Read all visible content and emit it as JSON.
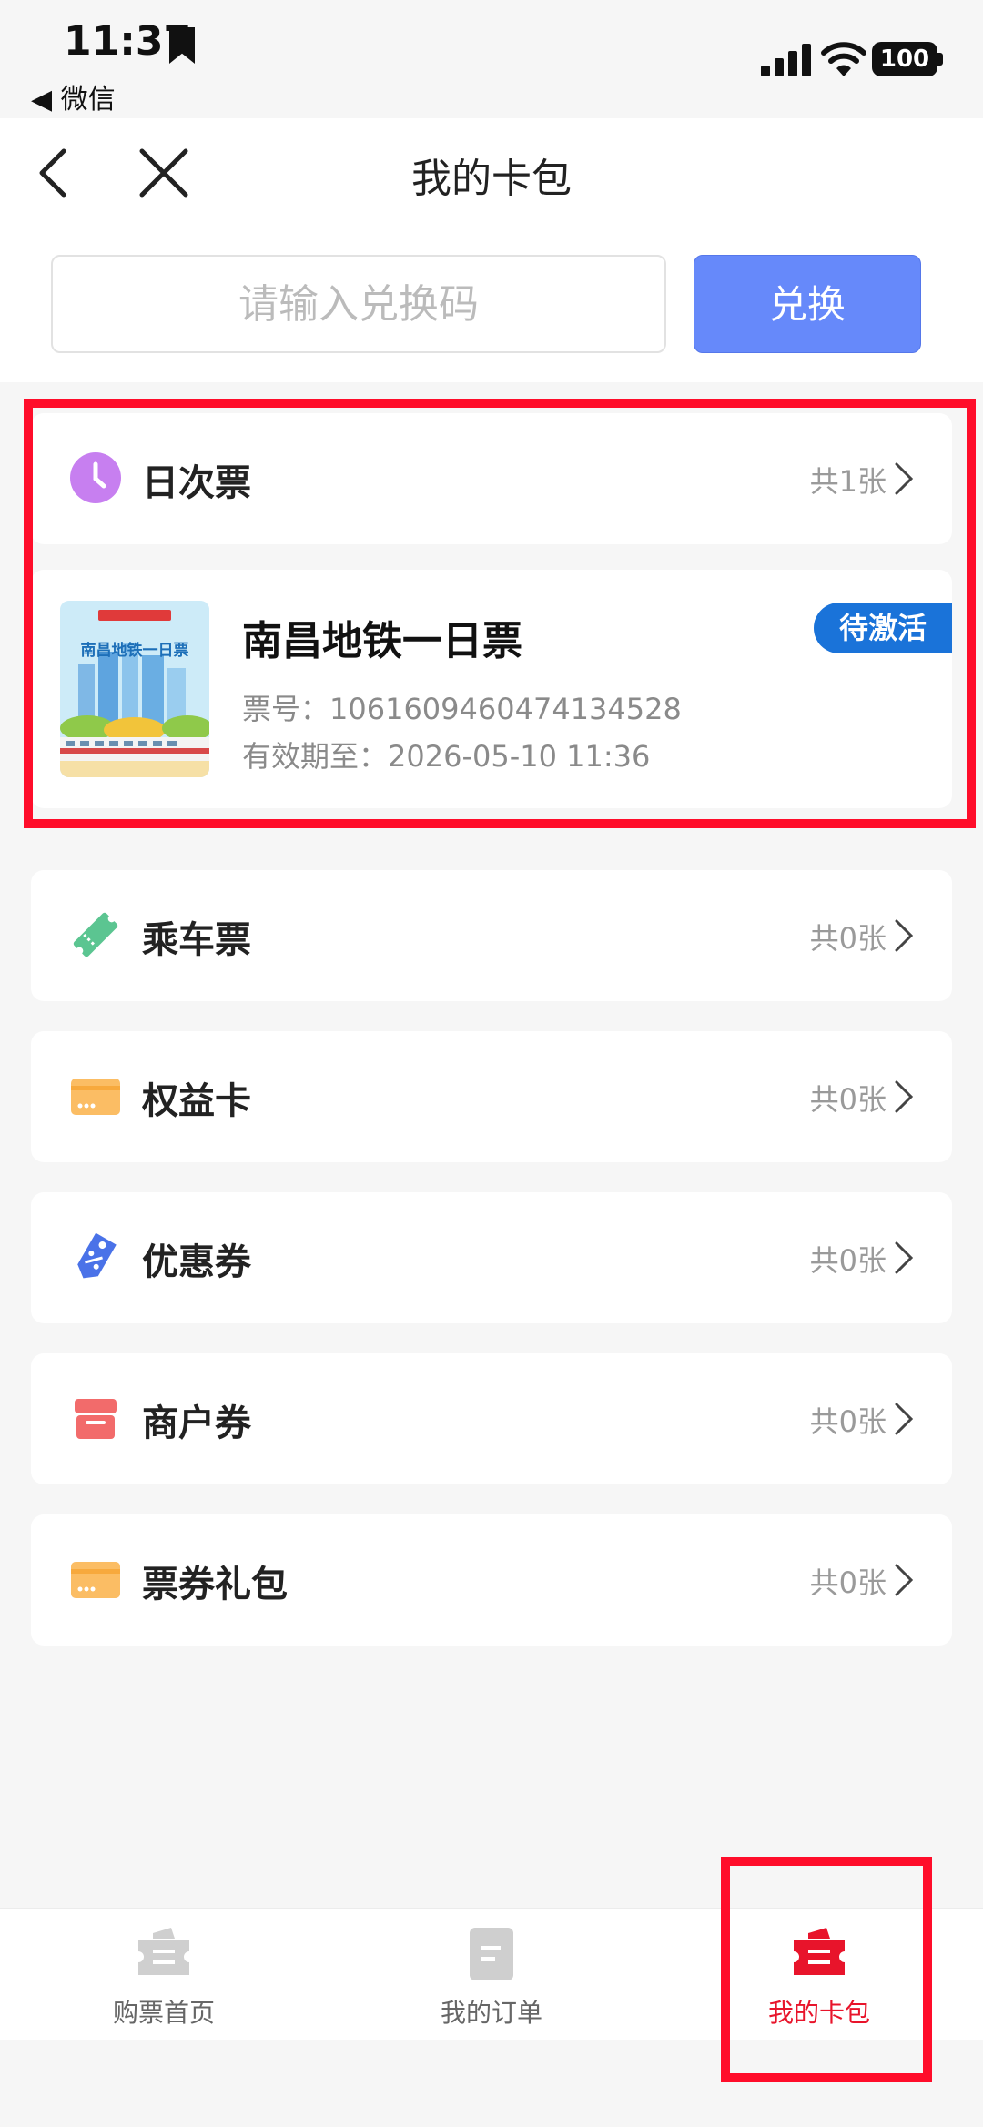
{
  "status_bar": {
    "time": "11:37",
    "back_app": "◀ 微信",
    "battery": "100"
  },
  "header": {
    "title": "我的卡包"
  },
  "redeem": {
    "placeholder": "请输入兑换码",
    "button": "兑换"
  },
  "sections": [
    {
      "label": "日次票",
      "count": "共1张",
      "icon": "clock-icon",
      "color": "#c77ff0"
    },
    {
      "label": "乘车票",
      "count": "共0张",
      "icon": "ticket-icon",
      "color": "#5bc591"
    },
    {
      "label": "权益卡",
      "count": "共0张",
      "icon": "card-icon",
      "color": "#fbbd64"
    },
    {
      "label": "优惠券",
      "count": "共0张",
      "icon": "tag-icon",
      "color": "#4a72e8"
    },
    {
      "label": "商户券",
      "count": "共0张",
      "icon": "store-icon",
      "color": "#f26b6b"
    },
    {
      "label": "票券礼包",
      "count": "共0张",
      "icon": "gift-card-icon",
      "color": "#fbbd64"
    }
  ],
  "ticket": {
    "name": "南昌地铁一日票",
    "number": "票号：1061609460474134528",
    "expiry": "有效期至：2026-05-10 11:36",
    "status": "待激活",
    "thumb_title": "南昌地铁一日票"
  },
  "tabs": [
    {
      "label": "购票首页",
      "icon": "ticket-home-icon"
    },
    {
      "label": "我的订单",
      "icon": "order-icon"
    },
    {
      "label": "我的卡包",
      "icon": "wallet-icon",
      "active": true
    }
  ],
  "colors": {
    "accent": "#6689fa",
    "badge": "#1a73d9",
    "highlight": "#ff0d2a",
    "active_tab": "#e8142b"
  }
}
